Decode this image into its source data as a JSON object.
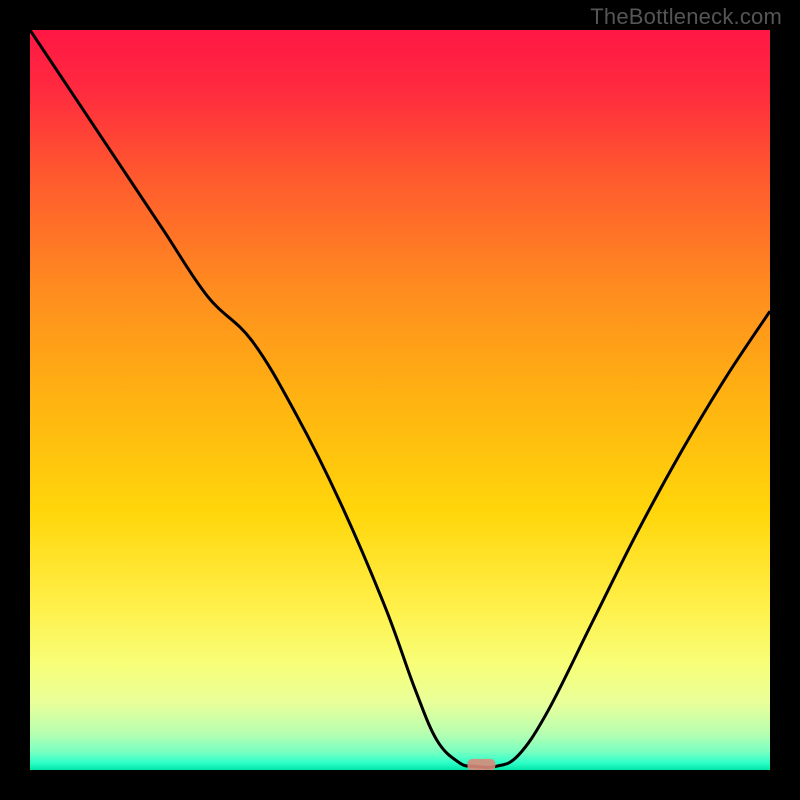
{
  "watermark": "TheBottleneck.com",
  "chart_data": {
    "type": "line",
    "title": "",
    "xlabel": "",
    "ylabel": "",
    "xlim": [
      0,
      100
    ],
    "ylim": [
      0,
      100
    ],
    "x": [
      0,
      6,
      12,
      18,
      24,
      30,
      36,
      42,
      48,
      52,
      55,
      58,
      60,
      63,
      66,
      70,
      76,
      82,
      88,
      94,
      100
    ],
    "values": [
      100,
      91,
      82,
      73,
      64,
      58,
      48,
      36,
      22,
      11,
      4,
      1,
      0.5,
      0.5,
      2,
      8,
      20,
      32,
      43,
      53,
      62
    ],
    "notch_marker": {
      "x": 61,
      "y": 0.7
    },
    "gradient_stops": [
      {
        "offset": 0.0,
        "color": "#ff1744"
      },
      {
        "offset": 0.08,
        "color": "#ff2a3f"
      },
      {
        "offset": 0.2,
        "color": "#ff5a2e"
      },
      {
        "offset": 0.35,
        "color": "#ff8c1f"
      },
      {
        "offset": 0.5,
        "color": "#ffb311"
      },
      {
        "offset": 0.65,
        "color": "#ffd60a"
      },
      {
        "offset": 0.78,
        "color": "#fff04a"
      },
      {
        "offset": 0.86,
        "color": "#f7ff7a"
      },
      {
        "offset": 0.91,
        "color": "#e8ff9a"
      },
      {
        "offset": 0.95,
        "color": "#b8ffb0"
      },
      {
        "offset": 0.975,
        "color": "#7affc1"
      },
      {
        "offset": 0.99,
        "color": "#30ffc9"
      },
      {
        "offset": 1.0,
        "color": "#00e6a8"
      }
    ]
  }
}
